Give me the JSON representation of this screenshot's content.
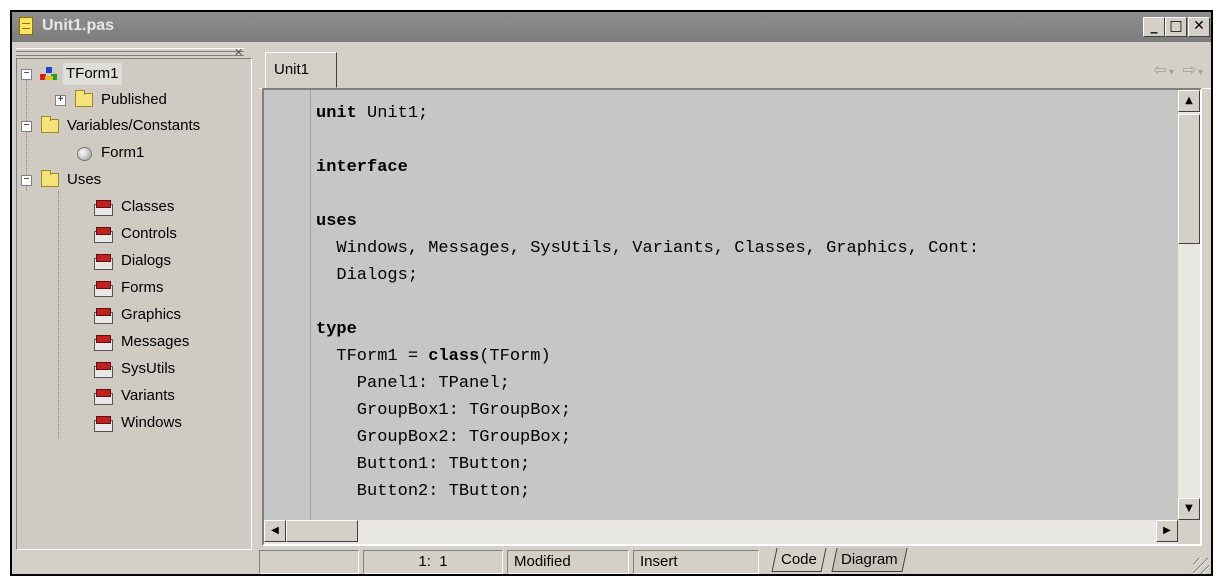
{
  "window": {
    "title": "Unit1.pas"
  },
  "icons": {
    "title": "file-icon",
    "unit": "delphi-unit-icon",
    "folder": "folder-icon",
    "component": "component-icon",
    "form": "form-class-icon"
  },
  "tree": {
    "root": {
      "label": "TForm1",
      "expanded": true
    },
    "published": {
      "label": "Published",
      "expanded": false
    },
    "varconst": {
      "label": "Variables/Constants",
      "expanded": true
    },
    "form1": {
      "label": "Form1"
    },
    "uses": {
      "label": "Uses",
      "expanded": true
    },
    "units": [
      "Classes",
      "Controls",
      "Dialogs",
      "Forms",
      "Graphics",
      "Messages",
      "SysUtils",
      "Variants",
      "Windows"
    ]
  },
  "editor": {
    "tab": "Unit1",
    "lines": [
      {
        "k": "unit",
        "r": " Unit1;"
      },
      {
        "t": ""
      },
      {
        "k": "interface",
        "r": ""
      },
      {
        "t": ""
      },
      {
        "k": "uses",
        "r": ""
      },
      {
        "t": "  Windows, Messages, SysUtils, Variants, Classes, Graphics, Cont:"
      },
      {
        "t": "  Dialogs;"
      },
      {
        "t": ""
      },
      {
        "k": "type",
        "r": ""
      },
      {
        "p": "  TForm1 = ",
        "k": "class",
        "r": "(TForm)"
      },
      {
        "t": "    Panel1: TPanel;"
      },
      {
        "t": "    GroupBox1: TGroupBox;"
      },
      {
        "t": "    GroupBox2: TGroupBox;"
      },
      {
        "t": "    Button1: TButton;"
      },
      {
        "t": "    Button2: TButton;"
      }
    ]
  },
  "status": {
    "cursor": "1:  1",
    "modified": "Modified",
    "mode": "Insert"
  },
  "bottom_tabs": {
    "code": "Code",
    "diagram": "Diagram",
    "active": "Code"
  }
}
